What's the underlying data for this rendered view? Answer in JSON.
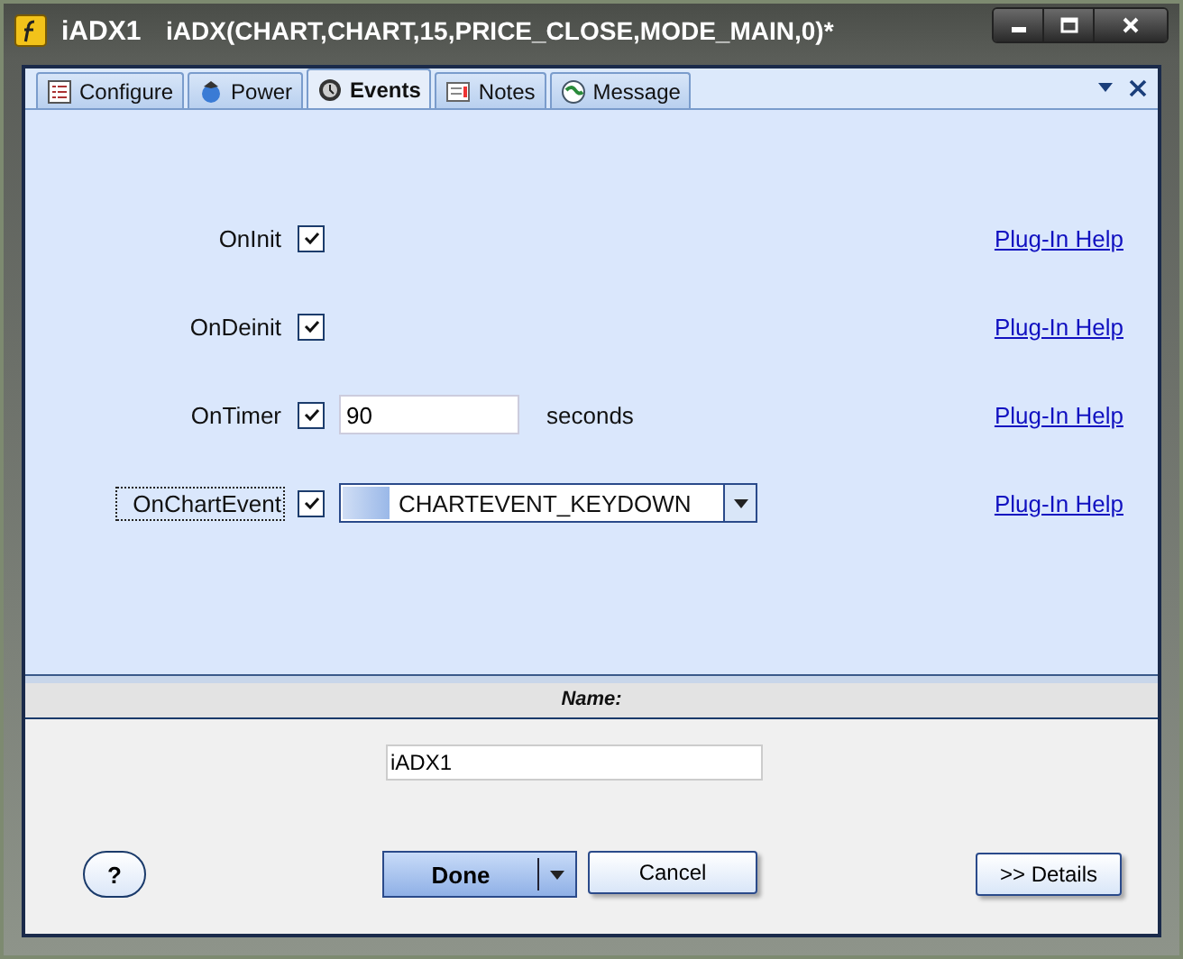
{
  "window": {
    "name": "iADX1",
    "title": "iADX(CHART,CHART,15,PRICE_CLOSE,MODE_MAIN,0)*"
  },
  "tabs": [
    {
      "label": "Configure",
      "selected": false
    },
    {
      "label": "Power",
      "selected": false
    },
    {
      "label": "Events",
      "selected": true
    },
    {
      "label": "Notes",
      "selected": false
    },
    {
      "label": "Message",
      "selected": false
    }
  ],
  "events": [
    {
      "kind": "check",
      "label": "OnInit",
      "checked": true,
      "focused": false,
      "help": "Plug-In Help"
    },
    {
      "kind": "check",
      "label": "OnDeinit",
      "checked": true,
      "focused": false,
      "help": "Plug-In Help"
    },
    {
      "kind": "timer",
      "label": "OnTimer",
      "checked": true,
      "focused": false,
      "value": "90",
      "unit": "seconds",
      "help": "Plug-In Help"
    },
    {
      "kind": "combo",
      "label": "OnChartEvent",
      "checked": true,
      "focused": true,
      "value": "CHARTEVENT_KEYDOWN",
      "help": "Plug-In Help"
    }
  ],
  "name_section": {
    "header": "Name:",
    "value": "iADX1"
  },
  "buttons": {
    "help": "?",
    "done": "Done",
    "cancel": "Cancel",
    "details": ">> Details"
  }
}
